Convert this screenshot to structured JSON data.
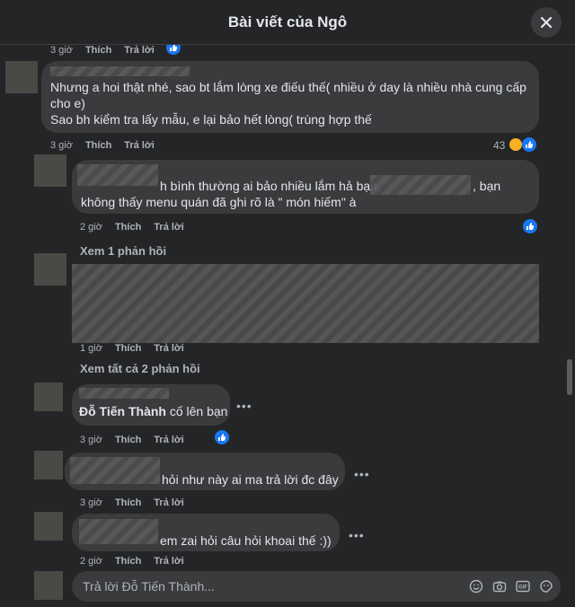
{
  "header": {
    "title": "Bài viết của Ngô"
  },
  "labels": {
    "like": "Thích",
    "reply": "Trả lời"
  },
  "comments": [
    {
      "time": "3 giờ"
    },
    {
      "lines": [
        "Nhưng a hoi thật nhé, sao bt lắm lòng xe điếu thế( nhiều ở day là nhiều nhà cung cấp",
        "cho e)",
        "Sao bh kiểm tra lấy mẫu, e lại bảo hết lòng( trùng hợp thế"
      ],
      "time": "3 giờ",
      "reaction_count": "43"
    },
    {
      "line1_a": "h bình thường ai bảo nhiều lắm hả bạn,",
      "line1_b": ", bạn",
      "line2": "không thấy menu quán đã ghi rõ là \" món hiếm\" à",
      "time": "2 giờ"
    },
    {
      "time": "1 giờ"
    },
    {
      "mention": "Đỗ Tiến Thành",
      "text": " cố lên bạn",
      "time": "3 giờ"
    },
    {
      "text": "hỏi như này ai ma trả lời đc đây",
      "time": "3 giờ"
    },
    {
      "text": "em zai hỏi câu hỏi khoai thế :))",
      "time": "2 giờ"
    }
  ],
  "view_replies": [
    "Xem 1 phản hồi",
    "Xem tất cả 2 phản hồi"
  ],
  "reply_box": {
    "placeholder": "Trả lời Đỗ Tiến Thành..."
  },
  "colors": {
    "background": "#242526",
    "bubble": "#3a3b3c",
    "like_blue": "#1877f2"
  }
}
